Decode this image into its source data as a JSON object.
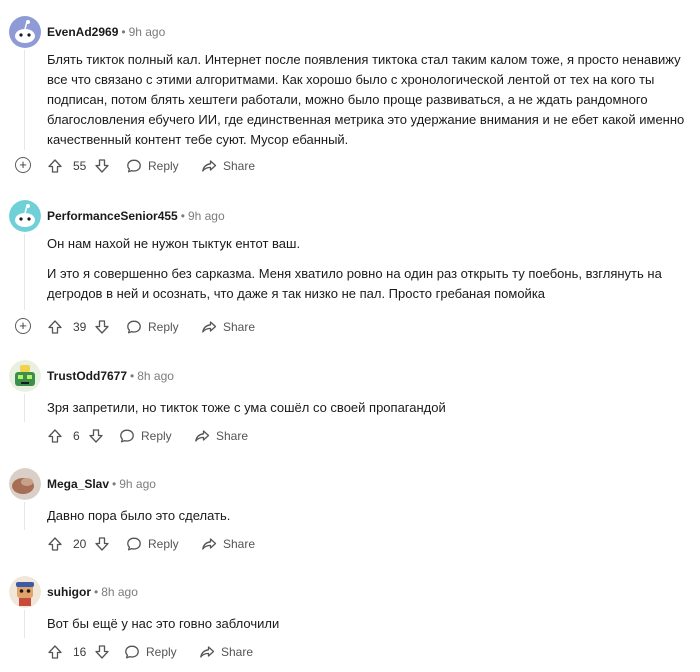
{
  "comments": [
    {
      "author": "EvenAd2969",
      "time": "9h ago",
      "paragraphs": [
        "Блять тикток полный кал. Интернет после появления тиктока стал таким калом тоже, я просто ненавижу все что связано с этими алгоритмами. Как хорошо было с хронологической лентой от тех на кого ты подписан, потом блять хештеги работали, можно было проще развиваться, а не ждать рандомного благословления ебучего ИИ, где единственная метрика это удержание внимания и не ебет какой именно качественный контент тебе суют. Мусор ебанный."
      ],
      "votes": "55",
      "reply": "Reply",
      "share": "Share",
      "avatar_color": "#8e9bd6"
    },
    {
      "author": "PerformanceSenior455",
      "time": "9h ago",
      "paragraphs": [
        "Он нам нахой не нужон тыктук ентот ваш.",
        "И это я совершенно без сарказма. Меня хватило ровно на один раз открыть ту поебонь, взглянуть на дегродов в ней и осознать, что даже я так низко не пал. Просто гребаная помойка"
      ],
      "votes": "39",
      "reply": "Reply",
      "share": "Share",
      "avatar_color": "#6fd0d8"
    },
    {
      "author": "TrustOdd7677",
      "time": "8h ago",
      "paragraphs": [
        "Зря запретили, но тикток тоже с ума сошёл со своей пропагандой"
      ],
      "votes": "6",
      "reply": "Reply",
      "share": "Share",
      "avatar_color": "#3c8f4a"
    },
    {
      "author": "Mega_Slav",
      "time": "9h ago",
      "paragraphs": [
        "Давно пора было это сделать."
      ],
      "votes": "20",
      "reply": "Reply",
      "share": "Share",
      "avatar_color": "#a56e55"
    },
    {
      "author": "suhigor",
      "time": "8h ago",
      "paragraphs": [
        "Вот бы ещё у нас это говно заблочили"
      ],
      "votes": "16",
      "reply": "Reply",
      "share": "Share",
      "avatar_color": "#3d5aa8"
    }
  ],
  "icons": {
    "expand": "plus-circle-icon",
    "upvote": "arrow-up-icon",
    "downvote": "arrow-down-icon",
    "reply": "speech-bubble-icon",
    "share": "share-arrow-icon"
  }
}
